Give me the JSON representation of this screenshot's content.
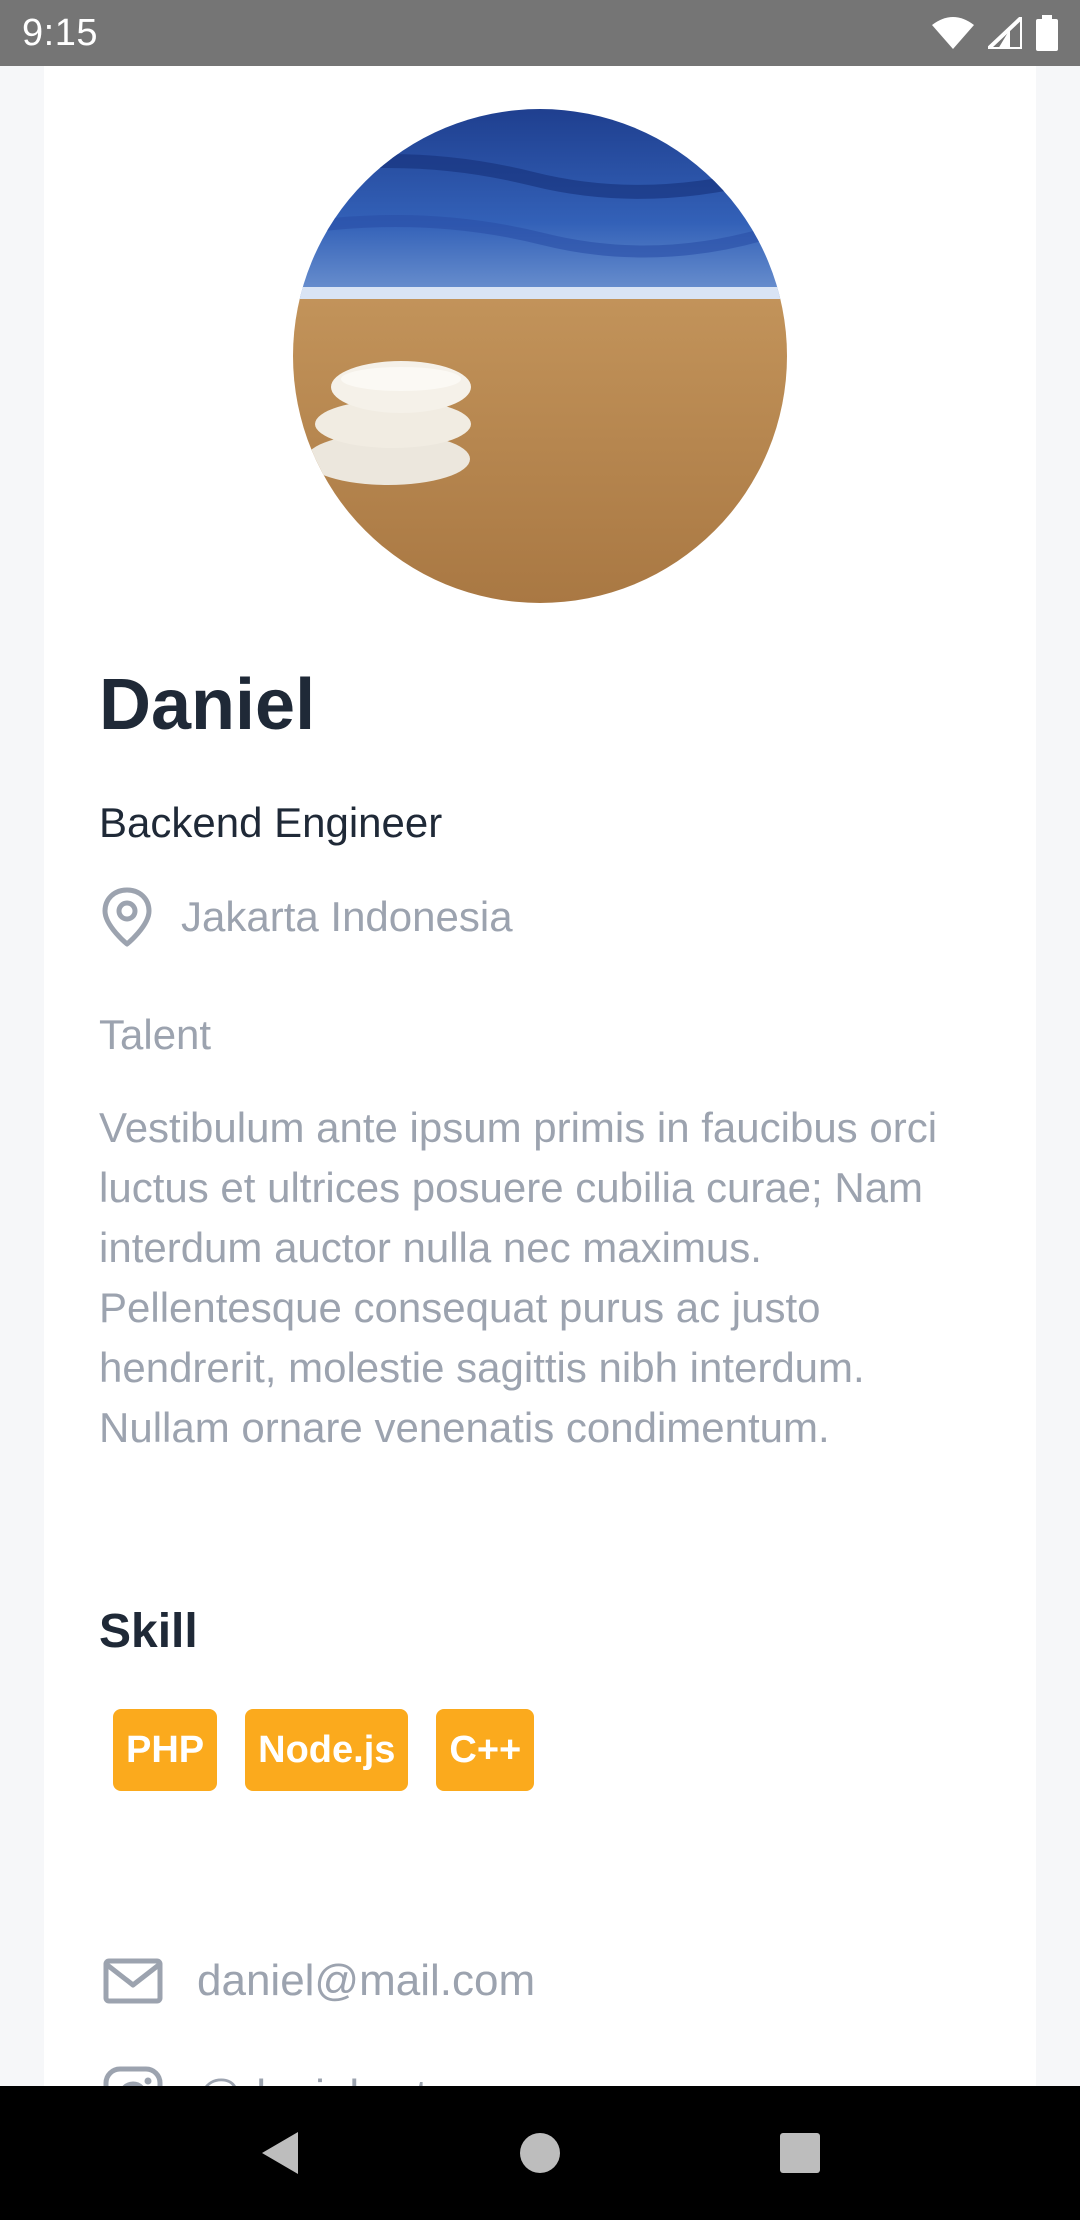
{
  "status_bar": {
    "time": "9:15",
    "icons": [
      "wifi-icon",
      "signal-icon",
      "battery-icon"
    ]
  },
  "profile": {
    "name": "Daniel",
    "role": "Backend Engineer",
    "location": "Jakarta Indonesia",
    "category": "Talent",
    "description": "Vestibulum ante ipsum primis in faucibus orci luctus et ultrices posuere cubilia curae; Nam interdum auctor nulla nec maximus. Pellentesque consequat purus ac justo hendrerit, molestie sagittis nibh interdum. Nullam ornare venenatis condimentum."
  },
  "skills": {
    "title": "Skill",
    "items": [
      "PHP",
      "Node.js",
      "C++"
    ]
  },
  "contacts": {
    "email": "daniel@mail.com",
    "instagram": "@danielwetan"
  },
  "colors": {
    "accent": "#fbaa1d",
    "heading": "#1f2937",
    "muted": "#9ca3af"
  },
  "nav": {
    "buttons": [
      "back-icon",
      "home-icon",
      "recents-icon"
    ]
  }
}
